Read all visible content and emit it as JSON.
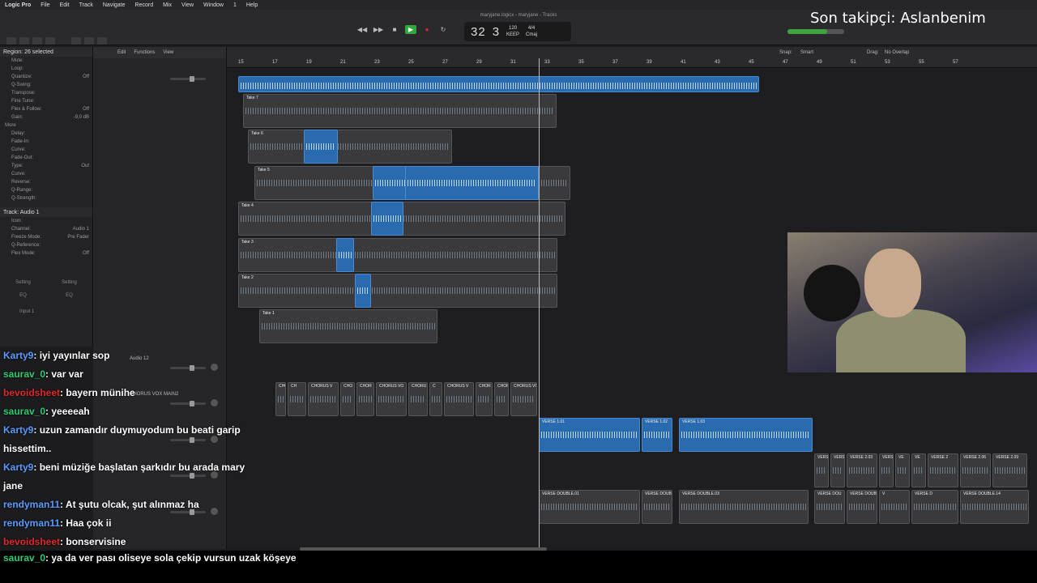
{
  "menubar": {
    "app": "Logic Pro",
    "items": [
      "File",
      "Edit",
      "Track",
      "Navigate",
      "Record",
      "Mix",
      "View",
      "Window",
      "1",
      "Help"
    ]
  },
  "window": {
    "title": "maryjane.logicx - maryjane - Tracks"
  },
  "lcd": {
    "bar": "32",
    "beat": "3",
    "tempo": "120",
    "timesig": "4/4",
    "key": "Cmaj",
    "bar_label": "BAR",
    "beat_label": "BEAT",
    "tempo_label": "KEEP",
    "key_label": "Tempo"
  },
  "overlay": {
    "follower": "Son takipçi: Aslanbenim"
  },
  "inspector": {
    "region_header": "Region: 26 selected",
    "rows": [
      [
        "Mute:",
        ""
      ],
      [
        "Loop:",
        ""
      ],
      [
        "Quantize:",
        "Off"
      ],
      [
        "Q-Swing:",
        ""
      ],
      [
        "Transpose:",
        ""
      ],
      [
        "Fine Tune:",
        ""
      ],
      [
        "Flex & Follow:",
        "Off"
      ],
      [
        "Gain:",
        "-9,0 dB"
      ]
    ],
    "more": "More",
    "more_rows": [
      [
        "Delay:",
        ""
      ],
      [
        "Fade-In:",
        ""
      ],
      [
        "Curve:",
        ""
      ],
      [
        "Fade-Out:",
        ""
      ],
      [
        "Type:",
        "Out"
      ],
      [
        "Curve:",
        ""
      ],
      [
        "Reverse:",
        ""
      ],
      [
        "Q-Range:",
        ""
      ],
      [
        "Q-Strength:",
        ""
      ]
    ],
    "track_header": "Track: Audio 1",
    "track_rows": [
      [
        "Icon:",
        ""
      ],
      [
        "Channel:",
        "Audio 1"
      ],
      [
        "Freeze Mode:",
        "Pre Fader"
      ],
      [
        "Q-Reference:",
        ""
      ],
      [
        "Flex Mode:",
        "Off"
      ]
    ],
    "setting1": "Setting",
    "setting2": "Setting",
    "eq1": "EQ",
    "eq2": "EQ",
    "input": "Input 1"
  },
  "arrange_toolbar": {
    "edit": "Edit",
    "functions": "Functions",
    "view": "View",
    "snap_label": "Snap:",
    "snap": "Smart",
    "drag_label": "Drag:",
    "drag": "No Overlap"
  },
  "ruler": [
    "15",
    "17",
    "19",
    "21",
    "23",
    "25",
    "27",
    "29",
    "31",
    "33",
    "35",
    "37",
    "39",
    "41",
    "43",
    "45",
    "47",
    "49",
    "51",
    "53",
    "55",
    "57"
  ],
  "tracks": {
    "audio12": "Audio 12",
    "chorus_main": "CHORUS VOX MAIN2",
    "msr": [
      "M",
      "S",
      "R",
      "I"
    ]
  },
  "takes": [
    "Take 7",
    "Take 6",
    "Take 5",
    "Take 4",
    "Take 3",
    "Take 2",
    "Take 1"
  ],
  "regions": {
    "chorus": [
      "CHORU",
      "CH",
      "CHORUS V",
      "CHO",
      "CHOR",
      "CHORUS VO",
      "CHORU",
      "C",
      "CHORUS V",
      "CHOR",
      "CHOR",
      "CHORUS VO"
    ],
    "verse": [
      "VERSE 1.01",
      "VERSE 1.02",
      "VERSE 1.03"
    ],
    "verse_small": [
      "VERS",
      "VERS",
      "VERSE 2.03",
      "VERS",
      "VE",
      "VE",
      "VERSE 2",
      "VERSE 2.06",
      "VERSE 2.09"
    ],
    "verse_double": [
      "VERSE DOUBLE.01",
      "VERSE DOUBL",
      "VERSE DOUBLE.03",
      "VERSE DOU",
      "VERSE DOUB",
      "V",
      "VERSE D",
      "VERSE DOUBLE.14"
    ]
  },
  "chat": [
    {
      "user": "Karty9",
      "color": "#5b9bff",
      "text": ": iyi yayınlar sop"
    },
    {
      "user": "saurav_0",
      "color": "#2ecc71",
      "text": ": var var"
    },
    {
      "user": "bevoidsheet",
      "color": "#e0282a",
      "text": ": bayern münihe"
    },
    {
      "user": "saurav_0",
      "color": "#2ecc71",
      "text": ": yeeeeah"
    },
    {
      "user": "Karty9",
      "color": "#5b9bff",
      "text": ": uzun zamandır duymuyodum bu beati garip hissettim.."
    },
    {
      "user": "Karty9",
      "color": "#5b9bff",
      "text": ": beni müziğe başlatan şarkıdır bu arada mary jane"
    },
    {
      "user": "rendyman11",
      "color": "#5b9bff",
      "text": ": At şutu olcak, şut alınmaz ha"
    },
    {
      "user": "rendyman11",
      "color": "#5b9bff",
      "text": ": Haa çok ii"
    },
    {
      "user": "bevoidsheet",
      "color": "#e0282a",
      "text": ": bonservisine"
    }
  ],
  "bottom_chat": {
    "user": "saurav_0",
    "color": "#2ecc71",
    "text": ": ya da ver pası oliseye sola çekip vursun uzak köşeye"
  }
}
